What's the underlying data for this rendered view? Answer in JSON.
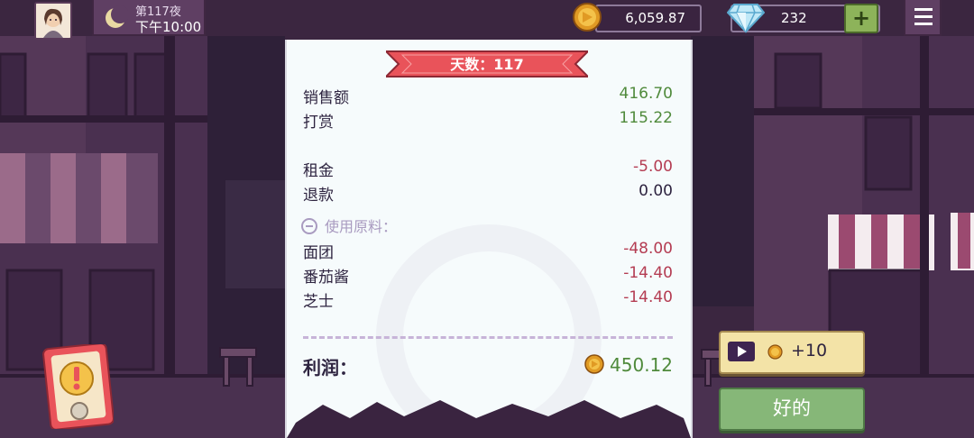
{
  "hud": {
    "day_label": "第117夜",
    "time_label": "下午10:00",
    "coins": "6,059.87",
    "gems": "232",
    "plus_label": "+"
  },
  "receipt": {
    "day_banner": "天数：117",
    "income": [
      {
        "label": "销售额",
        "value": "416.70"
      },
      {
        "label": "打赏",
        "value": "115.22"
      }
    ],
    "expenses": [
      {
        "label": "租金",
        "value": "-5.00"
      },
      {
        "label": "退款",
        "value": "0.00"
      }
    ],
    "materials_header": "使用原料：",
    "materials": [
      {
        "label": "面团",
        "value": "-48.00"
      },
      {
        "label": "番茄酱",
        "value": "-14.40"
      },
      {
        "label": "芝士",
        "value": "-14.40"
      }
    ],
    "profit_label": "利润：",
    "profit_value": "450.12"
  },
  "buttons": {
    "ad_reward": "+10",
    "ok": "好的"
  },
  "colors": {
    "positive": "#4f8a3b",
    "negative": "#b43c52",
    "banner": "#e9535a",
    "ok_button": "#86b778",
    "ad_button": "#f3e3a7"
  },
  "icons": [
    "avatar",
    "moon-icon",
    "coin-icon",
    "diamond-icon",
    "plus-icon",
    "menu-icon",
    "video-play-icon",
    "alert-icon",
    "collapse-icon"
  ]
}
